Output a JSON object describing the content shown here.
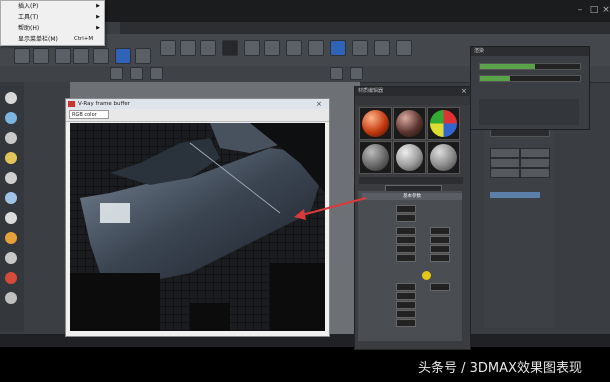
{
  "context_menu": {
    "items": [
      {
        "label": "插入(P)",
        "shortcut": "",
        "submenu": true
      },
      {
        "label": "工具(T)",
        "shortcut": "",
        "submenu": true
      },
      {
        "label": "帮助(H)",
        "shortcut": "",
        "submenu": true
      },
      {
        "label": "显示菜单栏(M)",
        "shortcut": "Ctrl+M",
        "submenu": false
      }
    ]
  },
  "frame_buffer": {
    "title": "V-Ray frame buffer",
    "channel": "RGB color"
  },
  "material_editor": {
    "title": "材质编辑器",
    "section_title": "基本参数"
  },
  "render_progress": {
    "title": "渲染"
  },
  "colors": {
    "accent_blue": "#2f63b8",
    "progress_green": "#5aa34a",
    "arrow_red": "#d93a3a",
    "cursor_yellow": "#e6c619"
  },
  "watermark": "头条号 / 3DMAX效果图表现"
}
